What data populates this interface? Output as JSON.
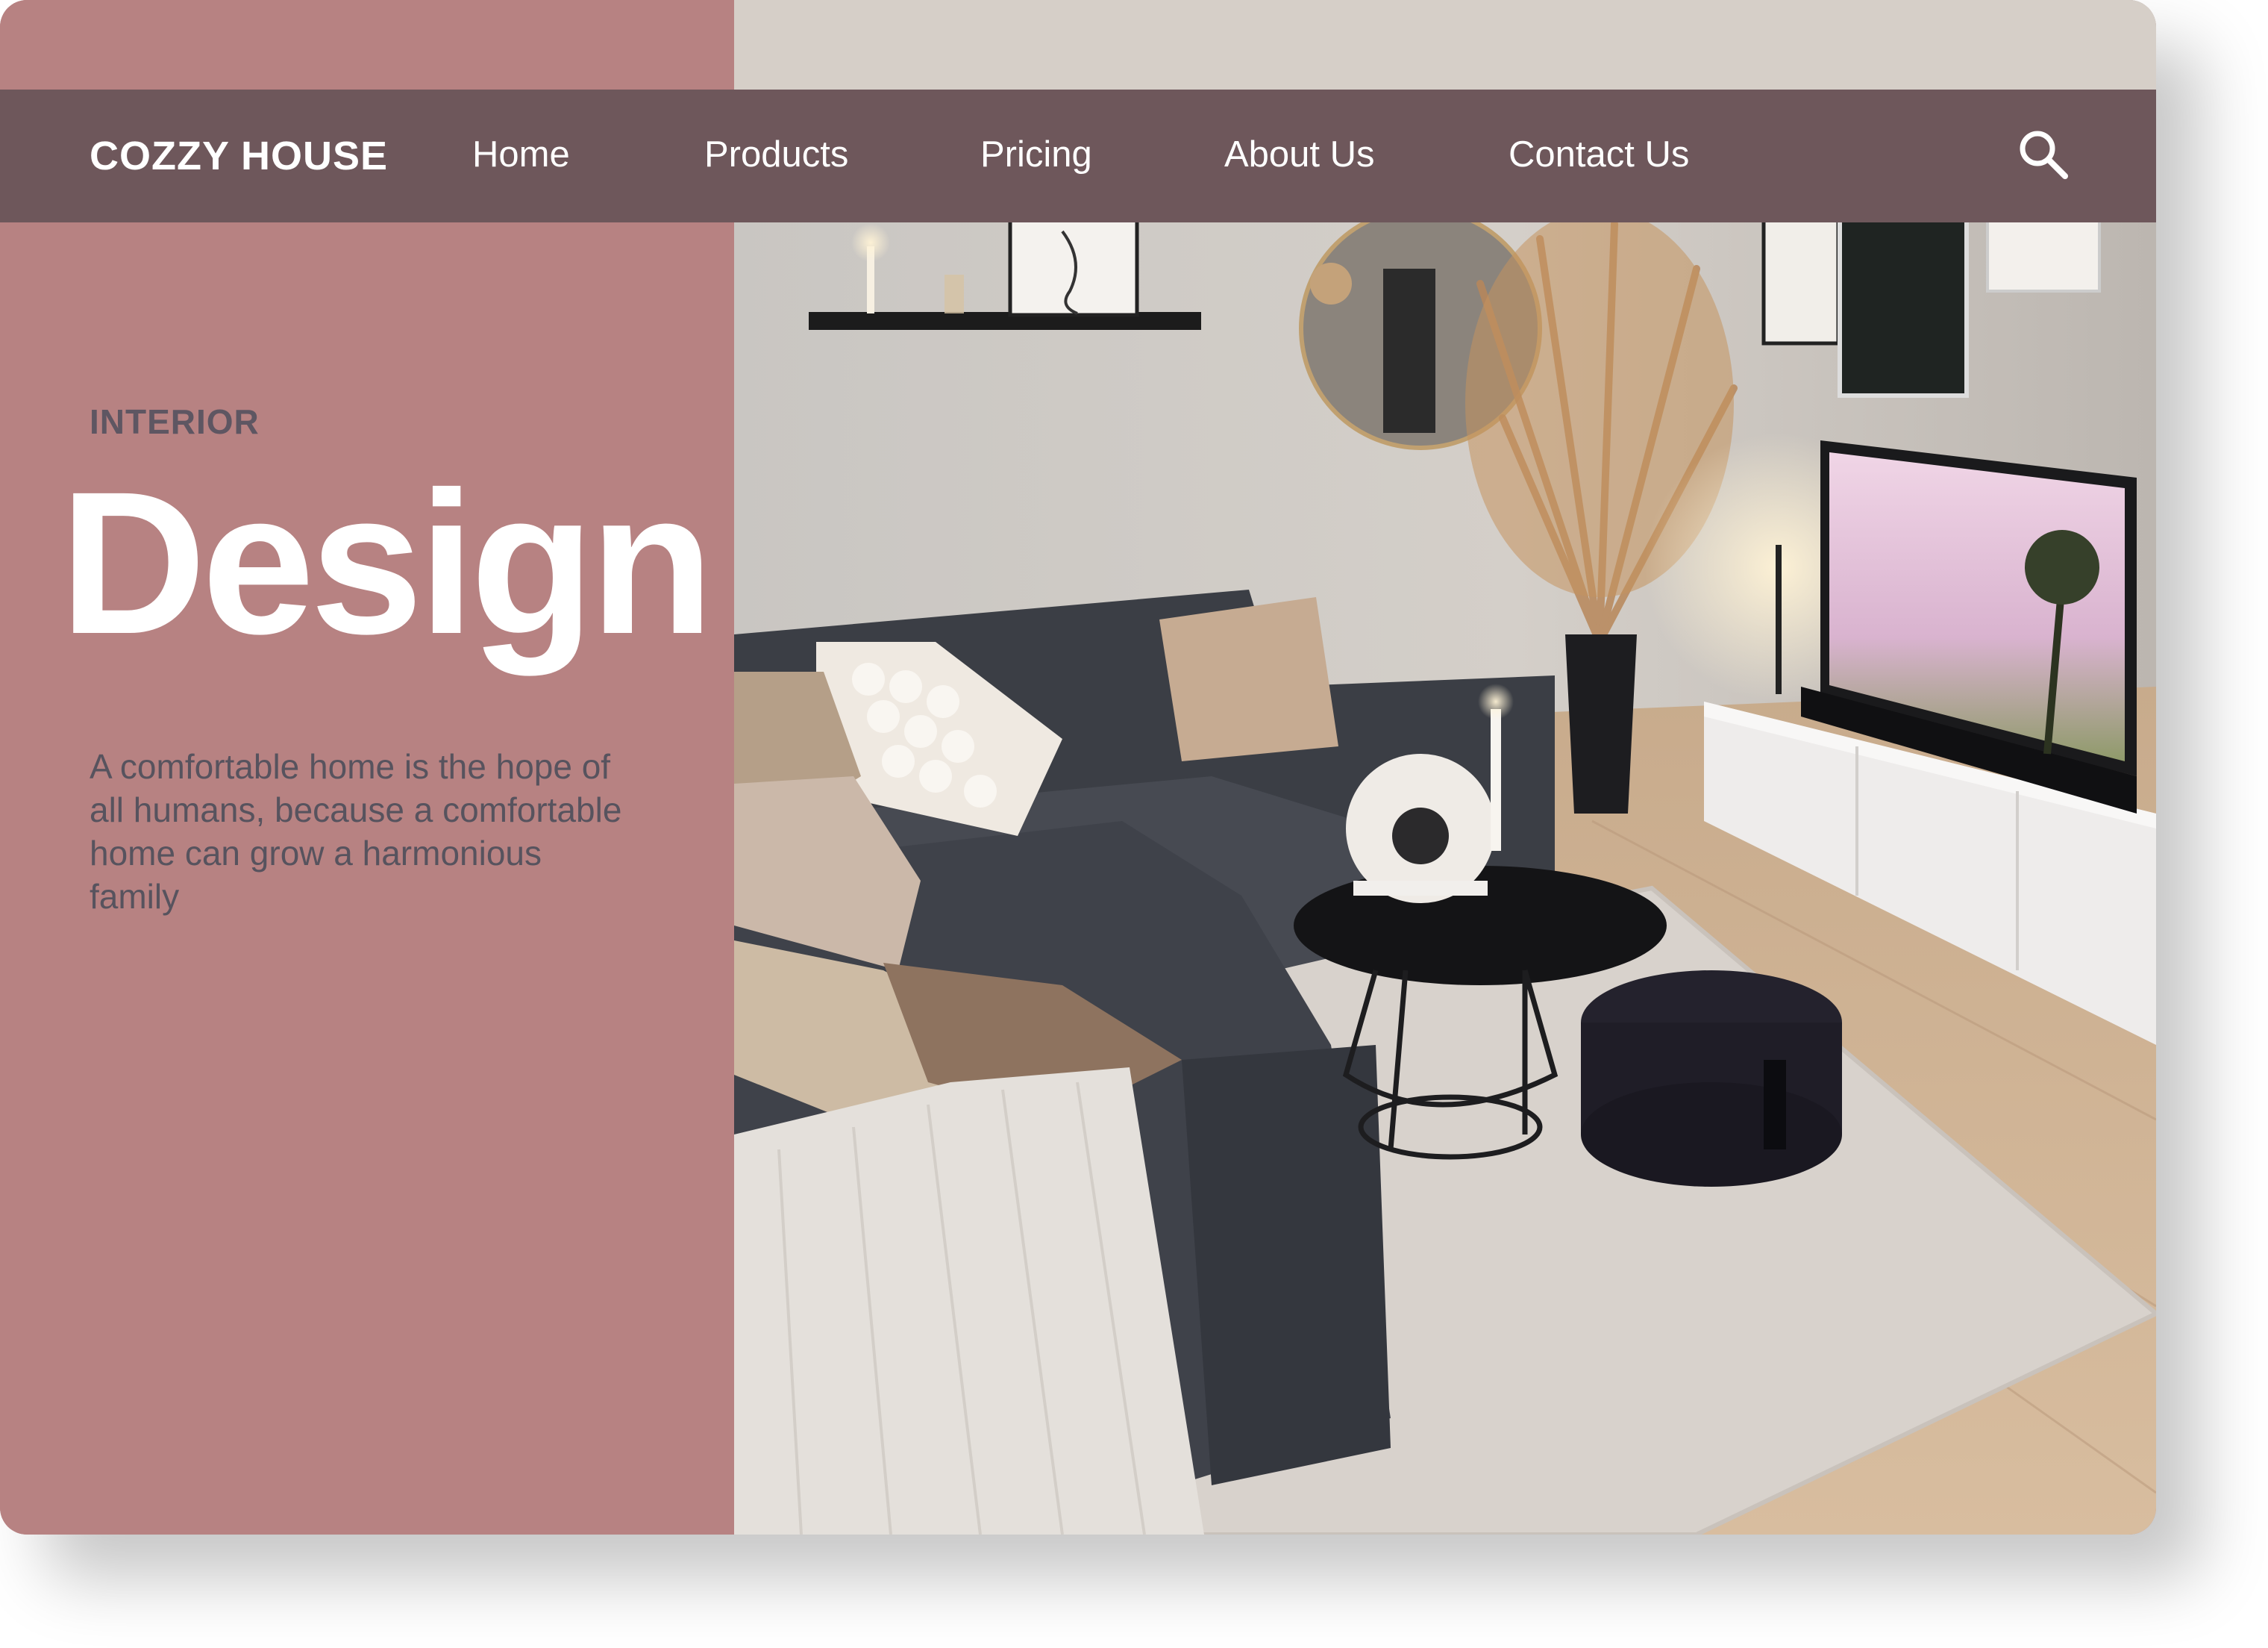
{
  "brand": {
    "name": "COZZY HOUSE"
  },
  "nav": {
    "items": [
      {
        "label": "Home"
      },
      {
        "label": "Products"
      },
      {
        "label": "Pricing"
      },
      {
        "label": "About Us"
      },
      {
        "label": "Contact Us"
      }
    ],
    "search_icon": "search-icon"
  },
  "hero": {
    "eyebrow": "INTERIOR",
    "title": "Design",
    "description": "A comfortable home is the hope of all humans, because a comfortable home can grow a harmonious family"
  },
  "colors": {
    "panel": "#b78282",
    "navbar": "#6e575b",
    "heading": "#ffffff",
    "text": "#57535e"
  }
}
